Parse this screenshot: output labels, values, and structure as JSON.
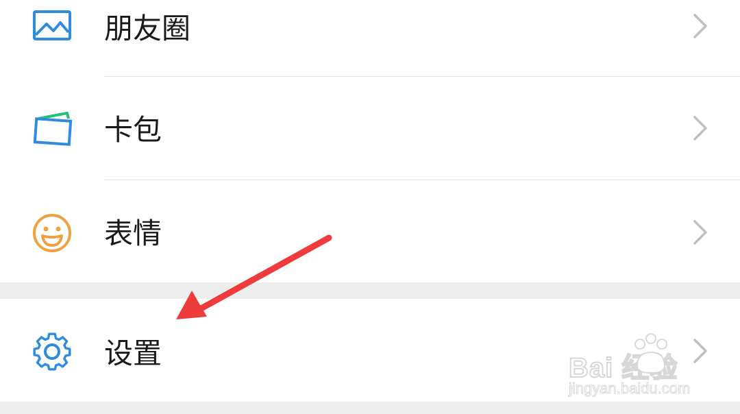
{
  "menu": {
    "items": [
      {
        "label": "朋友圈",
        "icon": "moments-image-icon"
      },
      {
        "label": "卡包",
        "icon": "card-wallet-icon"
      },
      {
        "label": "表情",
        "icon": "smiley-face-icon"
      },
      {
        "label": "设置",
        "icon": "gear-icon"
      }
    ]
  },
  "watermark": {
    "brand": "Bai  经验",
    "url": "jingyan.baidu.com"
  },
  "colors": {
    "background": "#ededed",
    "row": "#ffffff",
    "text": "#1a1a1a",
    "chevron": "#bfbfbf",
    "blue_icon": "#2f8be0",
    "green_accent": "#22c07a",
    "orange_icon": "#f0a040",
    "annotation_arrow": "#ee3b3b"
  }
}
